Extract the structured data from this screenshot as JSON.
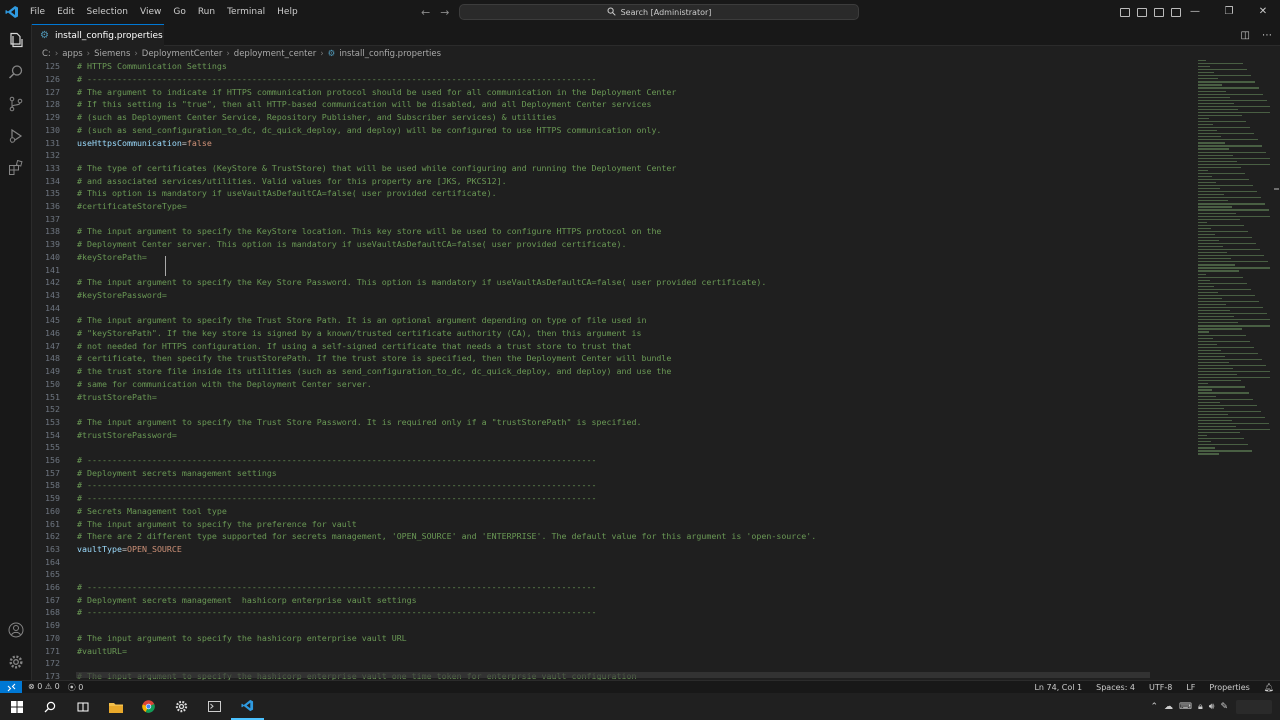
{
  "menu": [
    "File",
    "Edit",
    "Selection",
    "View",
    "Go",
    "Run",
    "Terminal",
    "Help"
  ],
  "search": {
    "text": "Search [Administrator]"
  },
  "tab": {
    "label": "install_config.properties"
  },
  "breadcrumb": [
    "C:",
    "apps",
    "Siemens",
    "DeploymentCenter",
    "deployment_center",
    "install_config.properties"
  ],
  "editor": {
    "lines": [
      {
        "n": "125",
        "t": "# HTTPS Communication Settings",
        "kind": "comment"
      },
      {
        "n": "126",
        "t": "# ------------------------------------------------------------------------------------------------------",
        "kind": "comment"
      },
      {
        "n": "127",
        "t": "# The argument to indicate if HTTPS communication protocol should be used for all communication in the Deployment Center",
        "kind": "comment"
      },
      {
        "n": "128",
        "t": "# If this setting is \"true\", then all HTTP-based communication will be disabled, and all Deployment Center services",
        "kind": "comment"
      },
      {
        "n": "129",
        "t": "# (such as Deployment Center Service, Repository Publisher, and Subscriber services) & utilities",
        "kind": "comment"
      },
      {
        "n": "130",
        "t": "# (such as send_configuration_to_dc, dc_quick_deploy, and deploy) will be configured to use HTTPS communication only.",
        "kind": "comment"
      },
      {
        "n": "131",
        "t": "useHttpsCommunication=false",
        "kind": "kv",
        "k": "useHttpsCommunication",
        "v": "false"
      },
      {
        "n": "132",
        "t": "",
        "kind": "comment"
      },
      {
        "n": "133",
        "t": "# The type of certificates (KeyStore & TrustStore) that will be used while configuring and running the Deployment Center",
        "kind": "comment"
      },
      {
        "n": "134",
        "t": "# and associated services/utilities. Valid values for this property are [JKS, PKCS12].",
        "kind": "comment"
      },
      {
        "n": "135",
        "t": "# This option is mandatory if useVaultAsDefaultCA=false( user provided certificate).",
        "kind": "comment"
      },
      {
        "n": "136",
        "t": "#certificateStoreType=",
        "kind": "comment"
      },
      {
        "n": "137",
        "t": "",
        "kind": "comment"
      },
      {
        "n": "138",
        "t": "# The input argument to specify the KeyStore location. This key store will be used to configure HTTPS protocol on the",
        "kind": "comment"
      },
      {
        "n": "139",
        "t": "# Deployment Center server. This option is mandatory if useVaultAsDefaultCA=false( user provided certificate).",
        "kind": "comment"
      },
      {
        "n": "140",
        "t": "#keyStorePath=",
        "kind": "comment"
      },
      {
        "n": "141",
        "t": "",
        "kind": "comment"
      },
      {
        "n": "142",
        "t": "# The input argument to specify the Key Store Password. This option is mandatory if useVaultAsDefaultCA=false( user provided certificate).",
        "kind": "comment"
      },
      {
        "n": "143",
        "t": "#keyStorePassword=",
        "kind": "comment"
      },
      {
        "n": "144",
        "t": "",
        "kind": "comment"
      },
      {
        "n": "145",
        "t": "# The input argument to specify the Trust Store Path. It is an optional argument depending on type of file used in",
        "kind": "comment"
      },
      {
        "n": "146",
        "t": "# \"keyStorePath\". If the key store is signed by a known/trusted certificate authority (CA), then this argument is",
        "kind": "comment"
      },
      {
        "n": "147",
        "t": "# not needed for HTTPS configuration. If using a self-signed certificate that needs a trust store to trust that",
        "kind": "comment"
      },
      {
        "n": "148",
        "t": "# certificate, then specify the trustStorePath. If the trust store is specified, then the Deployment Center will bundle",
        "kind": "comment"
      },
      {
        "n": "149",
        "t": "# the trust store file inside its utilities (such as send_configuration_to_dc, dc_quick_deploy, and deploy) and use the",
        "kind": "comment"
      },
      {
        "n": "150",
        "t": "# same for communication with the Deployment Center server.",
        "kind": "comment"
      },
      {
        "n": "151",
        "t": "#trustStorePath=",
        "kind": "comment"
      },
      {
        "n": "152",
        "t": "",
        "kind": "comment"
      },
      {
        "n": "153",
        "t": "# The input argument to specify the Trust Store Password. It is required only if a \"trustStorePath\" is specified.",
        "kind": "comment"
      },
      {
        "n": "154",
        "t": "#trustStorePassword=",
        "kind": "comment"
      },
      {
        "n": "155",
        "t": "",
        "kind": "comment"
      },
      {
        "n": "156",
        "t": "# ------------------------------------------------------------------------------------------------------",
        "kind": "comment"
      },
      {
        "n": "157",
        "t": "# Deployment secrets management settings",
        "kind": "comment"
      },
      {
        "n": "158",
        "t": "# ------------------------------------------------------------------------------------------------------",
        "kind": "comment"
      },
      {
        "n": "159",
        "t": "# ------------------------------------------------------------------------------------------------------",
        "kind": "comment"
      },
      {
        "n": "160",
        "t": "# Secrets Management tool type",
        "kind": "comment"
      },
      {
        "n": "161",
        "t": "# The input argument to specify the preference for vault",
        "kind": "comment"
      },
      {
        "n": "162",
        "t": "# There are 2 different type supported for secrets management, 'OPEN_SOURCE' and 'ENTERPRISE'. The default value for this argument is 'open-source'.",
        "kind": "comment"
      },
      {
        "n": "163",
        "t": "vaultType=OPEN_SOURCE",
        "kind": "kv",
        "k": "vaultType",
        "v": "OPEN_SOURCE"
      },
      {
        "n": "164",
        "t": "",
        "kind": "comment"
      },
      {
        "n": "165",
        "t": "",
        "kind": "comment"
      },
      {
        "n": "166",
        "t": "# ------------------------------------------------------------------------------------------------------",
        "kind": "comment"
      },
      {
        "n": "167",
        "t": "# Deployment secrets management  hashicorp enterprise vault settings",
        "kind": "comment"
      },
      {
        "n": "168",
        "t": "# ------------------------------------------------------------------------------------------------------",
        "kind": "comment"
      },
      {
        "n": "169",
        "t": "",
        "kind": "comment"
      },
      {
        "n": "170",
        "t": "# The input argument to specify the hashicorp enterprise vault URL",
        "kind": "comment"
      },
      {
        "n": "171",
        "t": "#vaultURL=",
        "kind": "comment"
      },
      {
        "n": "172",
        "t": "",
        "kind": "comment"
      },
      {
        "n": "173",
        "t": "# The input argument to specify the hashicorp enterprise vault one time token for enterprsie vault configuration",
        "kind": "comment"
      }
    ]
  },
  "status": {
    "errors": "0",
    "warnings": "0",
    "ports": "0",
    "position": "Ln 74, Col 1",
    "spaces": "Spaces: 4",
    "encoding": "UTF-8",
    "eol": "LF",
    "language": "Properties"
  },
  "colors": {
    "accent": "#0078d4",
    "comment": "#6a9955",
    "key": "#9cdcfe",
    "value": "#ce9178"
  }
}
